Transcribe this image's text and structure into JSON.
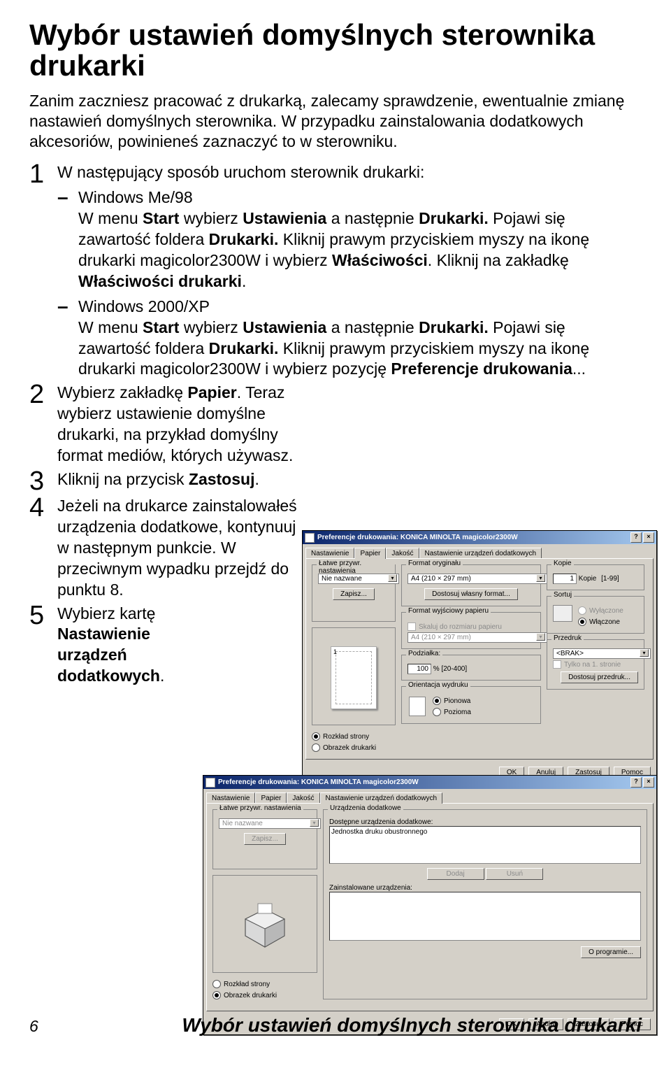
{
  "page": {
    "number": "6",
    "running_title": "Wybór ustawień domyślnych sterownika drukarki"
  },
  "heading": "Wybór ustawień domyślnych sterownika drukarki",
  "intro": "Zanim zaczniesz pracować z drukarką, zalecamy sprawdzenie, ewentualnie zmianę nastawień domyślnych sterownika. W przypadku zainstalowania dodatkowych akcesoriów, powinieneś zaznaczyć to w sterowniku.",
  "steps": {
    "s1": {
      "num": "1",
      "lead": "W następujący sposób uruchom sterownik drukarki:",
      "b1_head": "Windows Me/98",
      "b1_text": "W menu Start wybierz Ustawienia a następnie Drukarki. Pojawi się zawartość foldera Drukarki. Kliknij prawym przyciskiem myszy na ikonę drukarki magicolor2300W i wybierz Właściwości. Kliknij na zakładkę Właściwości drukarki.",
      "b2_head": "Windows 2000/XP",
      "b2_text": "W menu Start wybierz Ustawienia a następnie Drukarki. Pojawi się zawartość foldera Drukarki. Kliknij prawym przyciskiem myszy na ikonę drukarki magicolor2300W i wybierz pozycję Preferencje drukowania..."
    },
    "s2": {
      "num": "2",
      "text": "Wybierz zakładkę Papier. Teraz wybierz ustawienie domyślne drukarki, na przykład domyślny format mediów, których używasz."
    },
    "s3": {
      "num": "3",
      "text": "Kliknij na przycisk Zastosuj."
    },
    "s4": {
      "num": "4",
      "text": "Jeżeli na drukarce zainstalowałeś urządzenia dodatkowe, kontynuuj w następnym punkcie. W przeciwnym wypadku przejdź do punktu 8."
    },
    "s5": {
      "num": "5",
      "text": "Wybierz kartę Nastawienie urządzeń dodatkowych."
    }
  },
  "dlg1": {
    "title": "Preferencje drukowania: KONICA MINOLTA magicolor2300W",
    "tabs": {
      "t1": "Nastawienie",
      "t2": "Papier",
      "t3": "Jakość",
      "t4": "Nastawienie urządzeń dodatkowych"
    },
    "grp_easy": "Łatwe przywr. nastawienia",
    "easy_val": "Nie nazwane",
    "btn_save": "Zapisz...",
    "grp_format": "Format oryginału",
    "format_val": "A4 (210 × 297 mm)",
    "btn_custom": "Dostosuj własny format...",
    "grp_out": "Format wyjściowy papieru",
    "chk_scale": "Skaluj do rozmiaru papieru",
    "out_val": "A4 (210 × 297 mm)",
    "grp_nup": "Podziałka:",
    "nup_val": "100",
    "nup_range": "% [20-400]",
    "grp_orient": "Orientacja wydruku",
    "orient_p": "Pionowa",
    "orient_l": "Pozioma",
    "r_pagelay": "Rozkład strony",
    "r_prnthumb": "Obrazek drukarki",
    "grp_copies": "Kopie",
    "copies_val": "1",
    "copies_lbl": "Kopie",
    "copies_range": "[1-99]",
    "grp_sort": "Sortuj",
    "sort_off": "Wyłączone",
    "sort_on": "Włączone",
    "grp_pre": "Przedruk",
    "pre_val": "<BRAK>",
    "pre_chk": "Tylko na 1. stronie",
    "btn_pre": "Dostosuj przedruk...",
    "btn_ok": "OK",
    "btn_cancel": "Anuluj",
    "btn_apply": "Zastosuj",
    "btn_help": "Pomoc"
  },
  "dlg2": {
    "title": "Preferencje drukowania: KONICA MINOLTA magicolor2300W",
    "tabs": {
      "t1": "Nastawienie",
      "t2": "Papier",
      "t3": "Jakość",
      "t4": "Nastawienie urządzeń dodatkowych"
    },
    "grp_easy": "Łatwe przywr. nastawienia",
    "easy_val": "Nie nazwane",
    "btn_save": "Zapisz...",
    "grp_dev": "Urządzenia dodatkowe",
    "dev_lbl": "Dostępne urządzenia dodatkowe:",
    "dev_item": "Jednostka druku obustronnego",
    "btn_add": "Dodaj",
    "btn_del": "Usuń",
    "inst_lbl": "Zainstalowane urządzenia:",
    "r_pagelay": "Rozkład strony",
    "r_prnthumb": "Obrazek drukarki",
    "btn_about": "O programie...",
    "btn_ok": "OK",
    "btn_cancel": "Anuluj",
    "btn_apply": "Zastosuj",
    "btn_help": "Pomoc"
  }
}
